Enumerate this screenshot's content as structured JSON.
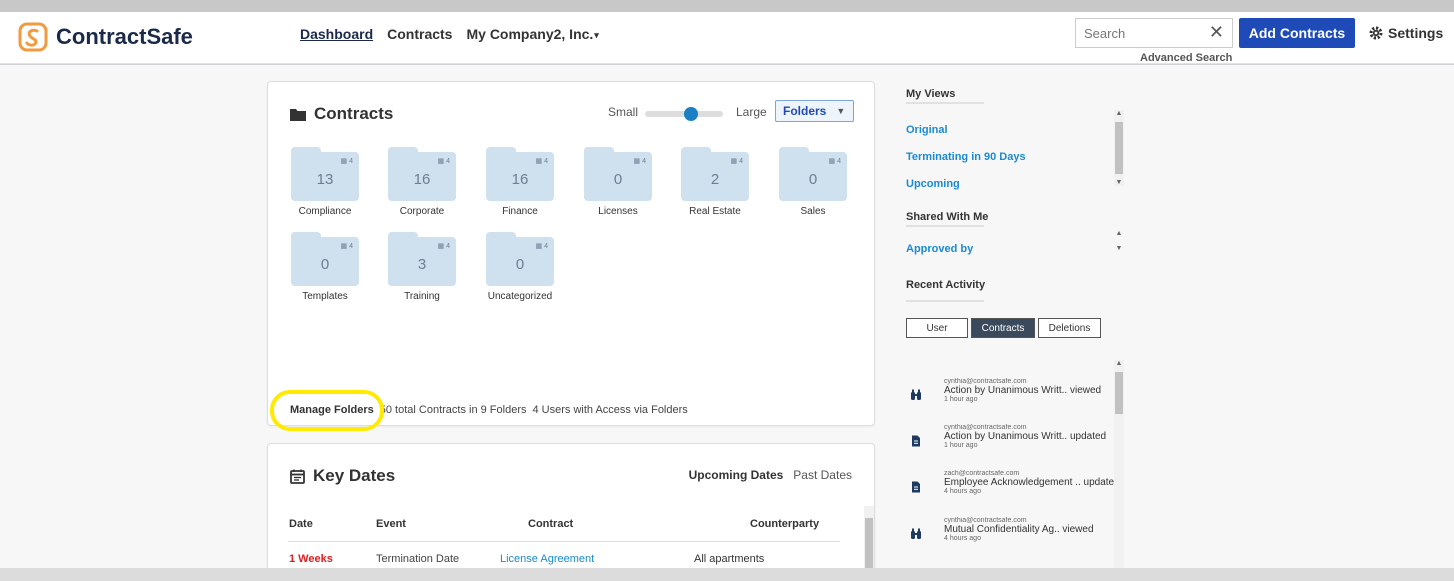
{
  "app": {
    "name": "ContractSafe",
    "brand_color": "#f19a3e",
    "accent": "#1f4bb8"
  },
  "nav": {
    "dashboard": "Dashboard",
    "contracts": "Contracts",
    "company": "My Company2, Inc."
  },
  "search": {
    "placeholder": "Search",
    "advanced": "Advanced Search"
  },
  "header": {
    "add_contracts": "Add Contracts",
    "settings": "Settings"
  },
  "contracts_card": {
    "title": "Contracts",
    "size_small": "Small",
    "size_large": "Large",
    "view_select": "Folders",
    "folders": [
      {
        "name": "Compliance",
        "count": "13",
        "users": "4"
      },
      {
        "name": "Corporate",
        "count": "16",
        "users": "4"
      },
      {
        "name": "Finance",
        "count": "16",
        "users": "4"
      },
      {
        "name": "Licenses",
        "count": "0",
        "users": "4"
      },
      {
        "name": "Real Estate",
        "count": "2",
        "users": "4"
      },
      {
        "name": "Sales",
        "count": "0",
        "users": "4"
      },
      {
        "name": "Templates",
        "count": "0",
        "users": "4"
      },
      {
        "name": "Training",
        "count": "3",
        "users": "4"
      },
      {
        "name": "Uncategorized",
        "count": "0",
        "users": "4"
      }
    ],
    "manage_folders": "Manage Folders",
    "summary": "50 total Contracts in 9 Folders",
    "users_summary": "4 Users with Access via Folders"
  },
  "key_dates": {
    "title": "Key Dates",
    "tab_upcoming": "Upcoming Dates",
    "tab_past": "Past Dates",
    "columns": {
      "date": "Date",
      "event": "Event",
      "contract": "Contract",
      "counterparty": "Counterparty"
    },
    "rows": [
      {
        "date": "1 Weeks",
        "event": "Termination Date",
        "contract": "License Agreement",
        "counterparty": "All apartments"
      }
    ]
  },
  "sidebar": {
    "my_views": "My Views",
    "views": [
      "Original",
      "Terminating in 90 Days",
      "Upcoming"
    ],
    "shared": "Shared With Me",
    "shared_views": [
      "Approved by"
    ],
    "recent": "Recent Activity",
    "activity_tabs": [
      "User",
      "Contracts",
      "Deletions"
    ],
    "activity": [
      {
        "email": "cynthia@contractsafe.com",
        "action": "Action by Unanimous Writt.. viewed",
        "time": "1 hour ago",
        "icon": "binoculars-icon"
      },
      {
        "email": "cynthia@contractsafe.com",
        "action": "Action by Unanimous Writt.. updated",
        "time": "1 hour ago",
        "icon": "document-icon"
      },
      {
        "email": "zach@contractsafe.com",
        "action": "Employee Acknowledgement .. updated",
        "time": "4 hours ago",
        "icon": "document-icon"
      },
      {
        "email": "cynthia@contractsafe.com",
        "action": "Mutual Confidentiality Ag.. viewed",
        "time": "4 hours ago",
        "icon": "binoculars-icon"
      }
    ]
  }
}
